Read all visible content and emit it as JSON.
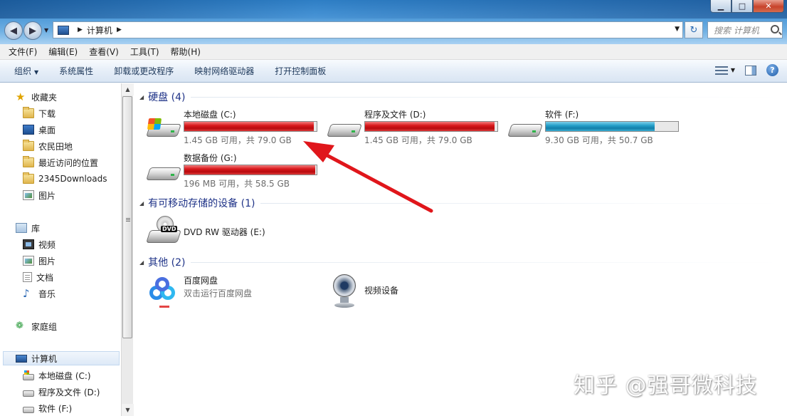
{
  "window": {
    "minimize_glyph": "▁",
    "maximize_glyph": "□",
    "close_glyph": "✕"
  },
  "address": {
    "path": "计算机",
    "search_placeholder": "搜索 计算机"
  },
  "menu": [
    "文件(F)",
    "编辑(E)",
    "查看(V)",
    "工具(T)",
    "帮助(H)"
  ],
  "toolbar": {
    "organize": "组织",
    "items": [
      "系统属性",
      "卸载或更改程序",
      "映射网络驱动器",
      "打开控制面板"
    ]
  },
  "nav": {
    "favorites": {
      "label": "收藏夹",
      "items": [
        "下载",
        "桌面",
        "农民田地",
        "最近访问的位置",
        "2345Downloads",
        "图片"
      ]
    },
    "libraries": {
      "label": "库",
      "items": [
        "视频",
        "图片",
        "文档",
        "音乐"
      ]
    },
    "homegroup": "家庭组",
    "computer": {
      "label": "计算机",
      "items": [
        "本地磁盘 (C:)",
        "程序及文件 (D:)",
        "软件 (F:)"
      ]
    }
  },
  "groups": {
    "hdd": "硬盘 (4)",
    "removable": "有可移动存储的设备 (1)",
    "other": "其他 (2)"
  },
  "drives": [
    {
      "name": "本地磁盘 (C:)",
      "size": "1.45 GB 可用，共 79.0 GB",
      "used_fraction": 0.98,
      "status": "red"
    },
    {
      "name": "程序及文件 (D:)",
      "size": "1.45 GB 可用，共 79.0 GB",
      "used_fraction": 0.98,
      "status": "blue-not-used-red"
    },
    {
      "name": "软件 (F:)",
      "size": "9.30 GB 可用，共 50.7 GB",
      "used_fraction": 0.82,
      "status": "blue"
    },
    {
      "name": "数据备份 (G:)",
      "size": "196 MB 可用，共 58.5 GB",
      "used_fraction": 0.99,
      "status": "red"
    }
  ],
  "removable": [
    {
      "name": "DVD RW 驱动器 (E:)",
      "badge": "DVD"
    }
  ],
  "other": [
    {
      "name": "百度网盘",
      "desc": "双击运行百度网盘"
    },
    {
      "name": "视频设备"
    }
  ],
  "colors": {
    "bar_red": "#d9191c",
    "bar_blue": "#26a0c9",
    "group_header": "#1e3287",
    "annotation_arrow": "#e0161b"
  },
  "watermark": "知乎 @强哥微科技"
}
